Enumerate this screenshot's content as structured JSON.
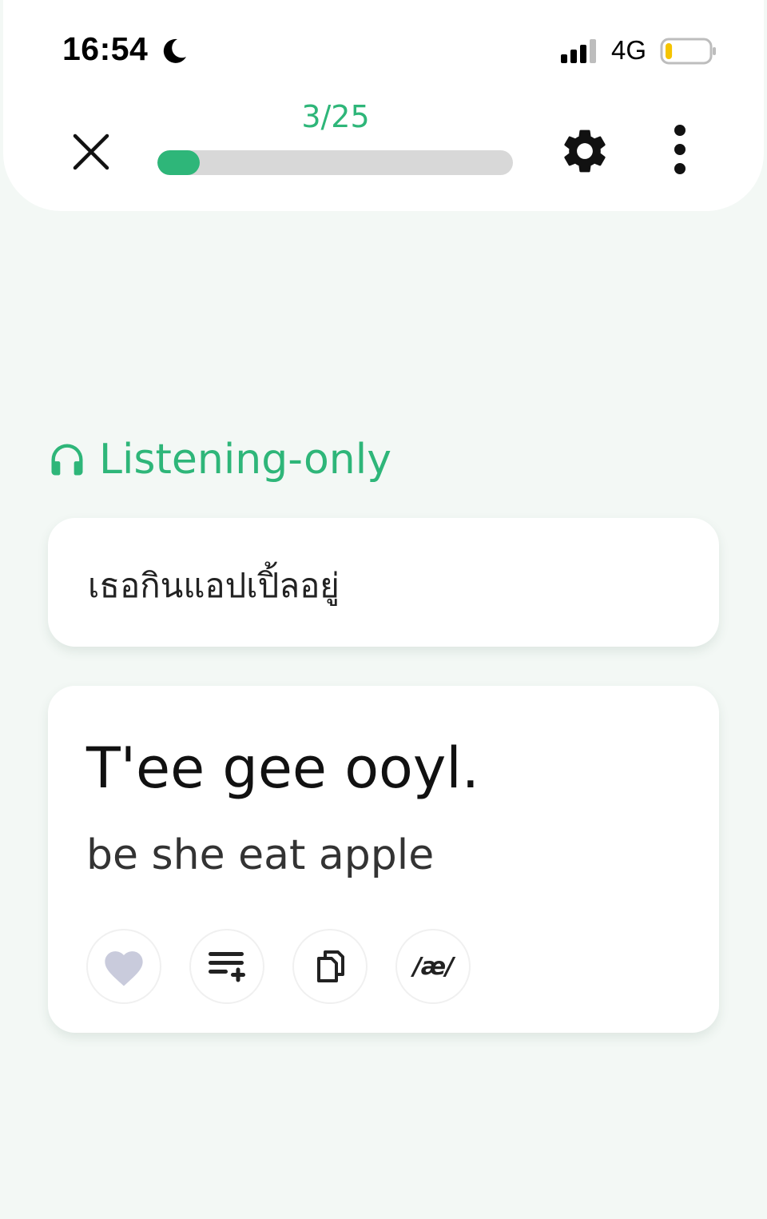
{
  "status_bar": {
    "time": "16:54",
    "network": "4G",
    "battery_level": 0.15,
    "battery_color": "#f5c400"
  },
  "header": {
    "progress_label": "3/25",
    "progress_current": 3,
    "progress_total": 25,
    "accent_color": "#2eb679",
    "close_icon": "close-icon",
    "settings_icon": "gear-icon",
    "more_icon": "more-vertical-icon"
  },
  "exercise": {
    "mode_icon": "headphones-icon",
    "mode_label": "Listening-only",
    "native_sentence": "เธอกินแอปเปิ้ลอยู่",
    "target_sentence": "T'ee gee ooyl.",
    "gloss": "be she eat apple",
    "actions": {
      "like_icon": "heart-icon",
      "add_to_list_icon": "playlist-add-icon",
      "copy_icon": "copy-icon",
      "ipa_label": "/æ/"
    }
  }
}
